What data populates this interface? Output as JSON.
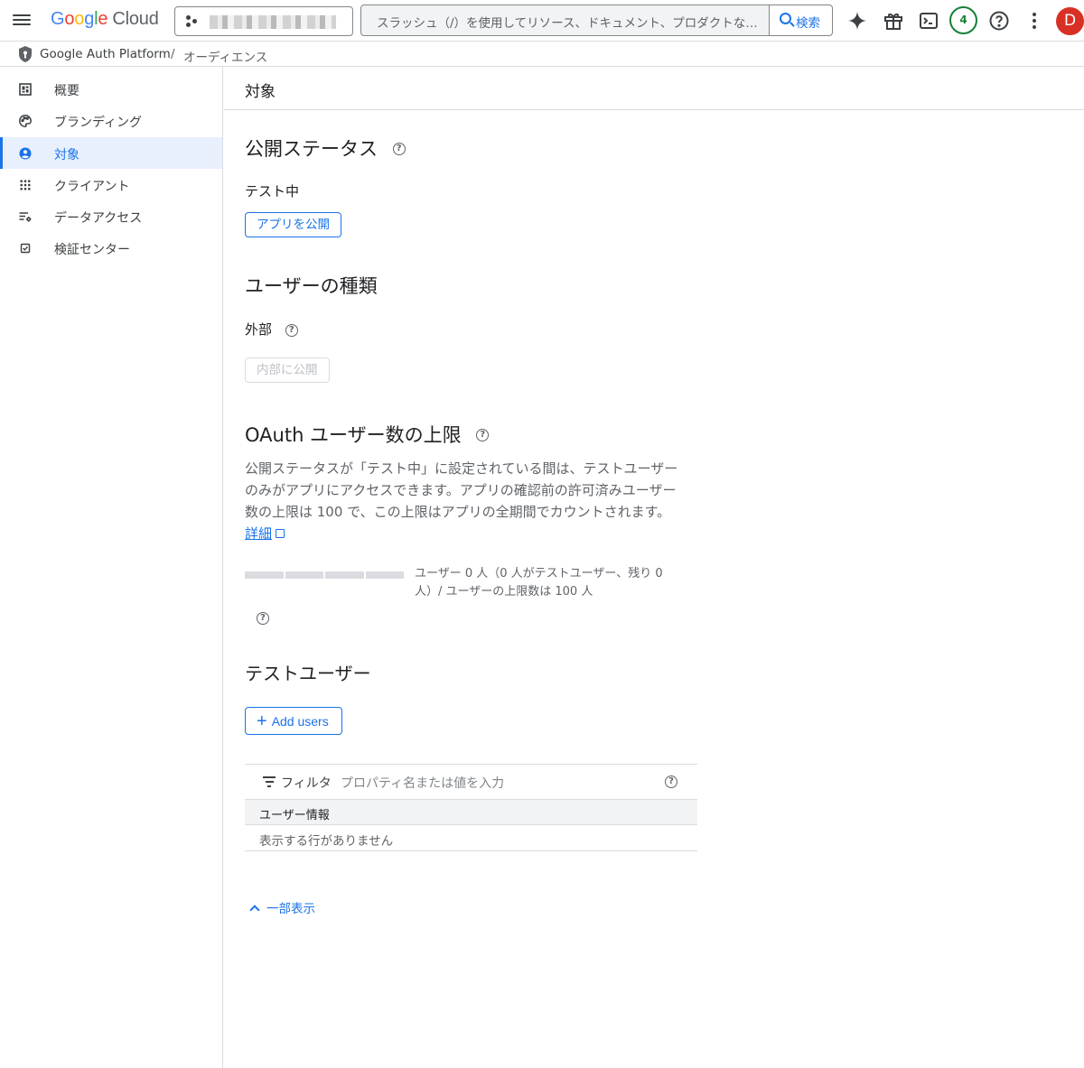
{
  "topbar": {
    "logo": [
      "G",
      "o",
      "o",
      "g",
      "l",
      "e"
    ],
    "logo_suffix": "Cloud",
    "search_placeholder": "スラッシュ（/）を使用してリソース、ドキュメント、プロダクトなど…",
    "search_button": "検索",
    "notification_count": "4",
    "avatar_letter": "D"
  },
  "breadcrumb": {
    "product": "Google Auth Platform",
    "separator": "/",
    "current": "オーディエンス"
  },
  "sidebar": {
    "items": [
      {
        "label": "概要",
        "icon": "dashboard-icon"
      },
      {
        "label": "ブランディング",
        "icon": "palette-icon"
      },
      {
        "label": "対象",
        "icon": "account-circle-icon",
        "active": true
      },
      {
        "label": "クライアント",
        "icon": "apps-grid-icon"
      },
      {
        "label": "データアクセス",
        "icon": "data-settings-icon"
      },
      {
        "label": "検証センター",
        "icon": "checkbox-icon"
      }
    ]
  },
  "main": {
    "title": "対象",
    "publish": {
      "heading": "公開ステータス",
      "status": "テスト中",
      "button": "アプリを公開"
    },
    "user_type": {
      "heading": "ユーザーの種類",
      "value": "外部",
      "button": "内部に公開"
    },
    "oauth_limit": {
      "heading": "OAuth ユーザー数の上限",
      "description_lines": [
        "公開ステータスが「テスト中」に設定されている間は、テストユーザー",
        "のみがアプリにアクセスできます。アプリの確認前の許可済みユーザー",
        "数の上限は 100 で、この上限はアプリの全期間でカウントされます。"
      ],
      "link": "詳細",
      "quota_text": "ユーザー 0 人（0 人がテストユーザー、残り 0 人）/ ユーザーの上限数は 100 人",
      "quota_used": 0,
      "quota_limit": 100
    },
    "test_users": {
      "heading": "テストユーザー",
      "add_button": "Add users",
      "filter_label": "フィルタ",
      "filter_placeholder": "プロパティ名または値を入力",
      "column_header": "ユーザー情報",
      "empty_message": "表示する行がありません"
    },
    "collapse_link": "一部表示"
  },
  "colors": {
    "accent": "#1a73e8",
    "active_bg": "#e8f0fe",
    "avatar": "#d93025",
    "badge": "#188038"
  }
}
